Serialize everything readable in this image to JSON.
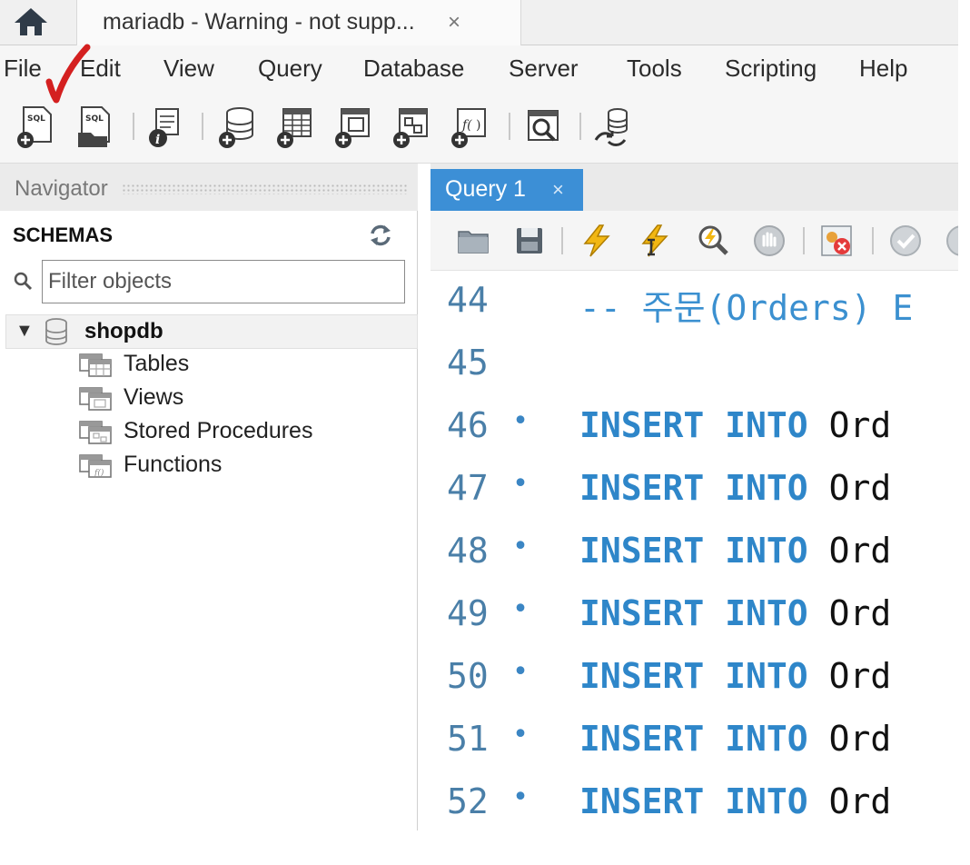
{
  "connection_tab": {
    "label": "mariadb - Warning - not supp...",
    "close": "×"
  },
  "menu": [
    "File",
    "Edit",
    "View",
    "Query",
    "Database",
    "Server",
    "Tools",
    "Scripting",
    "Help"
  ],
  "toolbar": {
    "icons": [
      "new-sql-tab-icon",
      "open-sql-script-icon",
      "inspector-icon",
      "create-schema-icon",
      "create-table-icon",
      "create-view-icon",
      "create-procedure-icon",
      "create-function-icon",
      "search-table-data-icon",
      "reconnect-icon"
    ]
  },
  "navigator": {
    "title": "Navigator",
    "schemas_label": "SCHEMAS",
    "filter_placeholder": "Filter objects",
    "schema": {
      "name": "shopdb",
      "expanded_glyph": "▼",
      "children": [
        "Tables",
        "Views",
        "Stored Procedures",
        "Functions"
      ]
    }
  },
  "editor": {
    "tab": {
      "label": "Query 1",
      "close": "×"
    },
    "lines": [
      {
        "num": "44",
        "dot": "",
        "kw": "",
        "rest": "-- 주문(Orders) E",
        "type": "comment"
      },
      {
        "num": "45",
        "dot": "",
        "kw": "",
        "rest": "",
        "type": "blank"
      },
      {
        "num": "46",
        "dot": "•",
        "kw": "INSERT INTO",
        "rest": "Ord",
        "type": "code"
      },
      {
        "num": "47",
        "dot": "•",
        "kw": "INSERT INTO",
        "rest": "Ord",
        "type": "code"
      },
      {
        "num": "48",
        "dot": "•",
        "kw": "INSERT INTO",
        "rest": "Ord",
        "type": "code"
      },
      {
        "num": "49",
        "dot": "•",
        "kw": "INSERT INTO",
        "rest": "Ord",
        "type": "code"
      },
      {
        "num": "50",
        "dot": "•",
        "kw": "INSERT INTO",
        "rest": "Ord",
        "type": "code"
      },
      {
        "num": "51",
        "dot": "•",
        "kw": "INSERT INTO",
        "rest": "Ord",
        "type": "code"
      },
      {
        "num": "52",
        "dot": "•",
        "kw": "INSERT INTO",
        "rest": "Ord",
        "type": "code"
      }
    ]
  },
  "colors": {
    "accent": "#3c8fd6",
    "keyword": "#2e86c9",
    "line_number": "#4a7fa8",
    "annotation_mark": "#d42020"
  }
}
